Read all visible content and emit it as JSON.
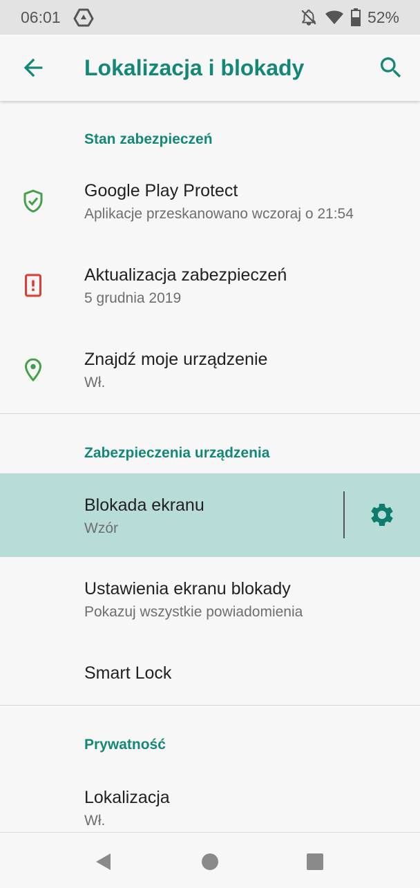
{
  "status_bar": {
    "time": "06:01",
    "battery": "52%",
    "icons": [
      "drive-icon",
      "notifications-off-icon",
      "wifi-icon",
      "battery-icon"
    ]
  },
  "app_bar": {
    "title": "Lokalizacja i blokady",
    "back_icon": "arrow-back-icon",
    "search_icon": "search-icon"
  },
  "sections": {
    "security_status": {
      "header": "Stan zabezpieczeń",
      "items": [
        {
          "title": "Google Play Protect",
          "subtitle": "Aplikacje przeskanowano wczoraj o 21:54",
          "icon": "shield-check-icon"
        },
        {
          "title": "Aktualizacja zabezpieczeń",
          "subtitle": "5 grudnia 2019",
          "icon": "phone-alert-icon"
        },
        {
          "title": "Znajdź moje urządzenie",
          "subtitle": "Wł.",
          "icon": "location-pin-icon"
        }
      ]
    },
    "device_security": {
      "header": "Zabezpieczenia urządzenia",
      "items": [
        {
          "title": "Blokada ekranu",
          "subtitle": "Wzór",
          "icon": "gear-icon"
        },
        {
          "title": "Ustawienia ekranu blokady",
          "subtitle": "Pokazuj wszystkie powiadomienia"
        },
        {
          "title": "Smart Lock"
        }
      ]
    },
    "privacy": {
      "header": "Prywatność",
      "items": [
        {
          "title": "Lokalizacja",
          "subtitle": "Wł."
        }
      ]
    }
  },
  "colors": {
    "accent": "#138877",
    "shield_green": "#43a047",
    "alert_red": "#e53935",
    "highlight": "#b8dcd8"
  },
  "nav_bar": {
    "icons": [
      "nav-back-icon",
      "nav-home-icon",
      "nav-recents-icon"
    ]
  }
}
